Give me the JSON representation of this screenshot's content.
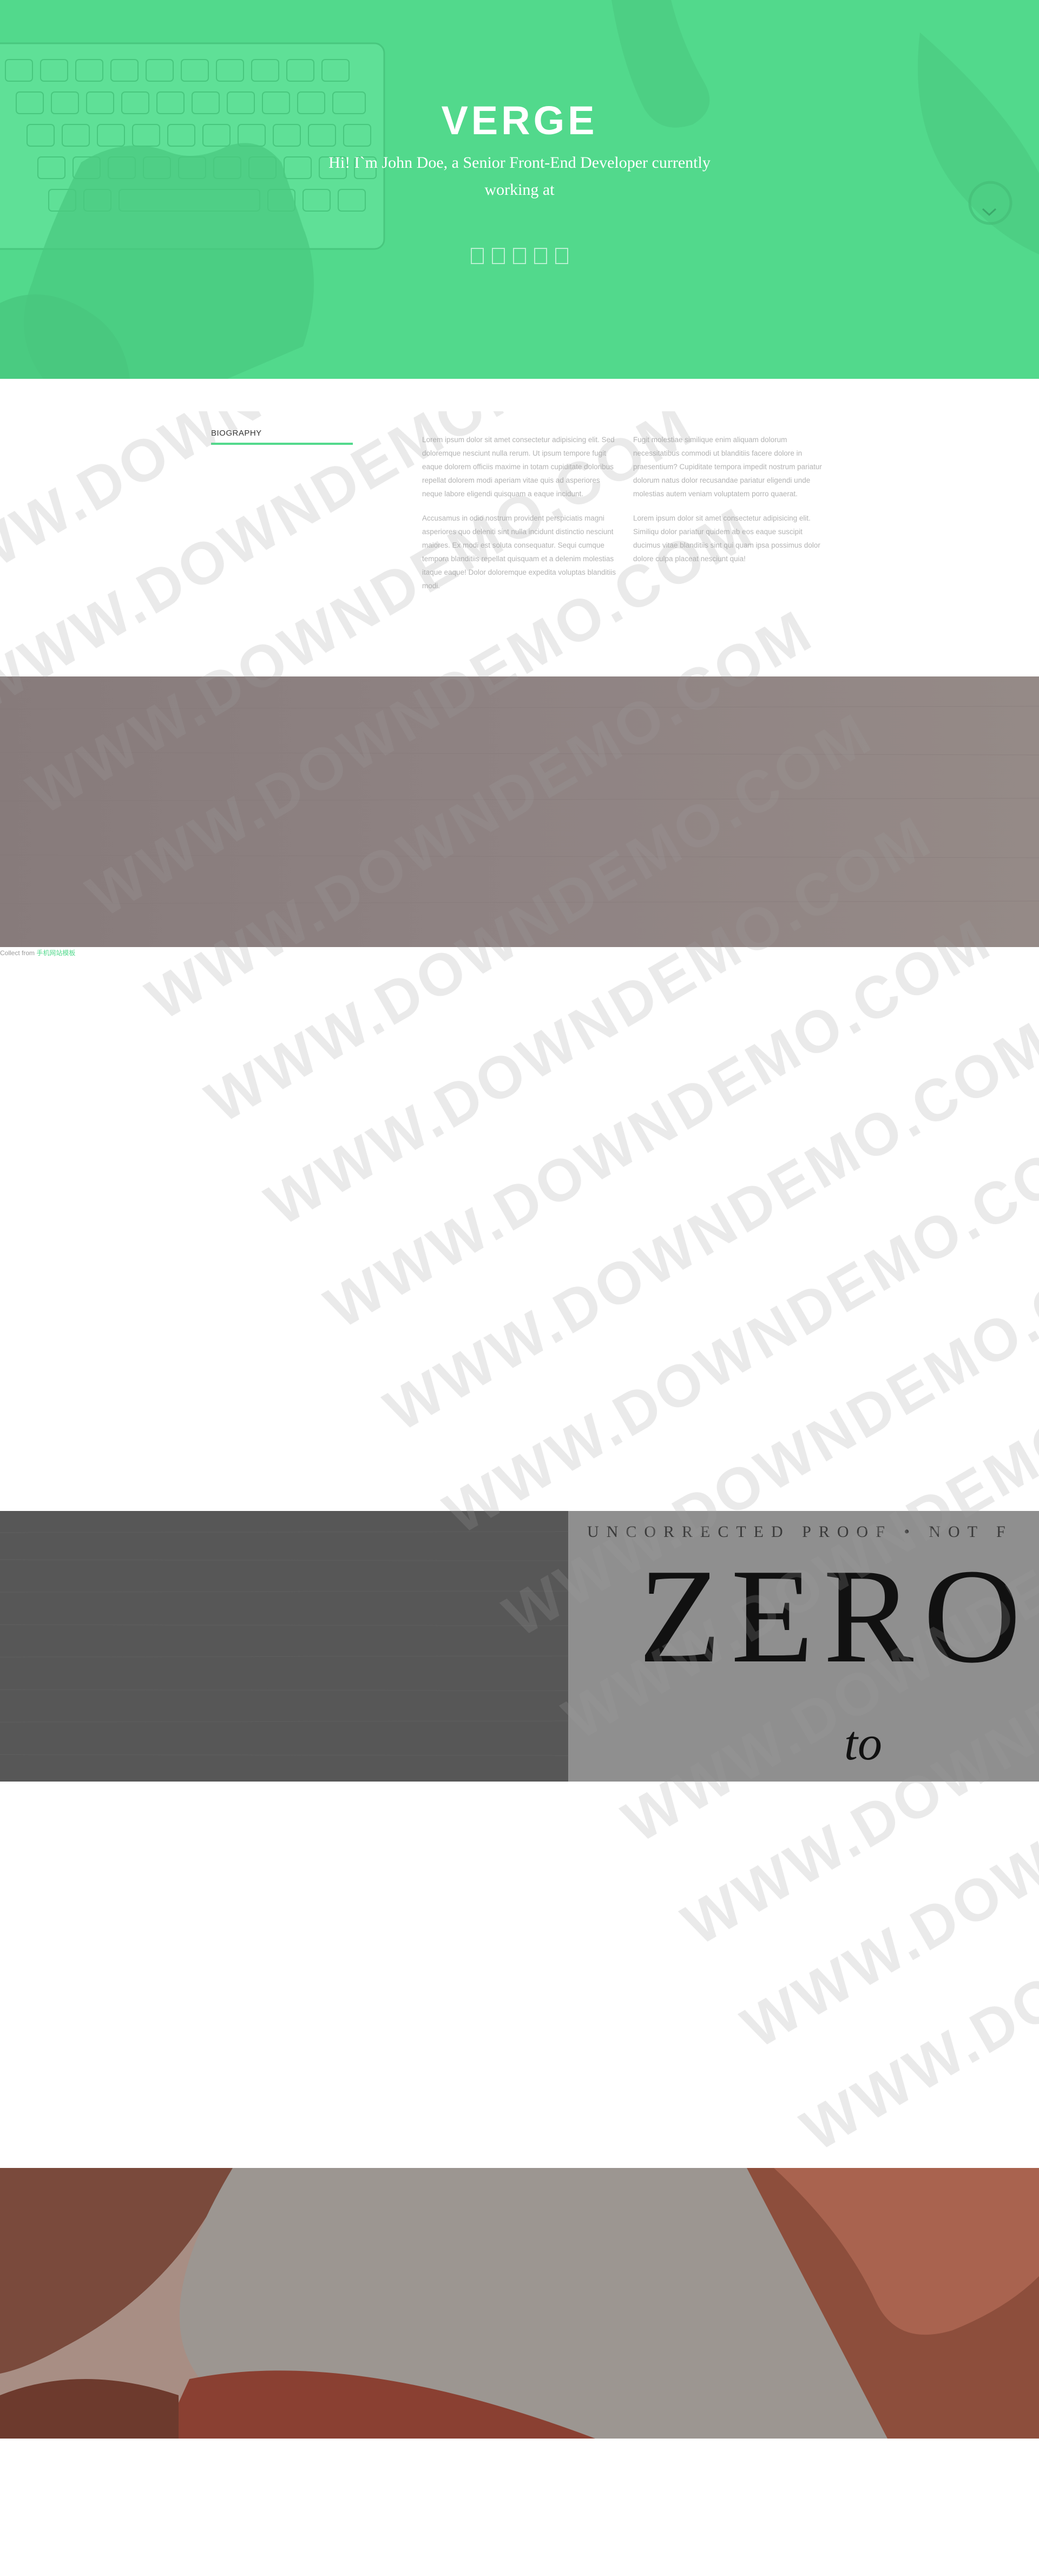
{
  "hero": {
    "title": "VERGE",
    "subtitle": "Hi! I`m John Doe, a Senior Front-End Developer currently working at",
    "social_count": 5,
    "color": "#52d98c"
  },
  "biography": {
    "label": "BIOGRAPHY",
    "col1": [
      "Lorem ipsum dolor sit amet consectetur adipisicing elit. Sed doloremque nesciunt nulla rerum. Ut ipsum tempore fugit eaque dolorem officiis maxime in totam cupiditate doloribus repellat dolorem modi aperiam vitae quis ad asperiores neque labore eligendi quisquam a eaque incidunt.",
      "Accusamus in odio nostrum provident perspiciatis magni asperiores quo deleniti sint nulla incidunt distinctio nesciunt maiores. Ex modi est soluta consequatur. Sequi cumque tempora blanditiis repellat quisquam et a delenim molestias itaque eaque! Dolor doloremque expedita voluptas blanditiis modi."
    ],
    "col2": [
      "Fugit molestiae similique enim aliquam dolorum necessitatibus commodi ut blanditiis facere dolore in praesentium? Cupiditate tempora impedit nostrum pariatur dolorum natus dolor recusandae pariatur eligendi unde molestias autem veniam voluptatem porro quaerat.",
      "Lorem ipsum dolor sit amet consectetur adipisicing elit. Similiqu dolor pariatur quidem ab eos eaque suscipit ducimus vitae blanditiis sint qui quam ipsa possimus dolor dolore culpa placeat nesciunt quia!"
    ]
  },
  "bands": {
    "proof_text": "UNCORRECTED PROOF • NOT F",
    "book_title": "ZERO",
    "book_sub": "to"
  },
  "credit": {
    "prefix": "Collect from ",
    "link": "手机网站模板"
  },
  "watermark": "WWW.DOWNDEMO.COM"
}
